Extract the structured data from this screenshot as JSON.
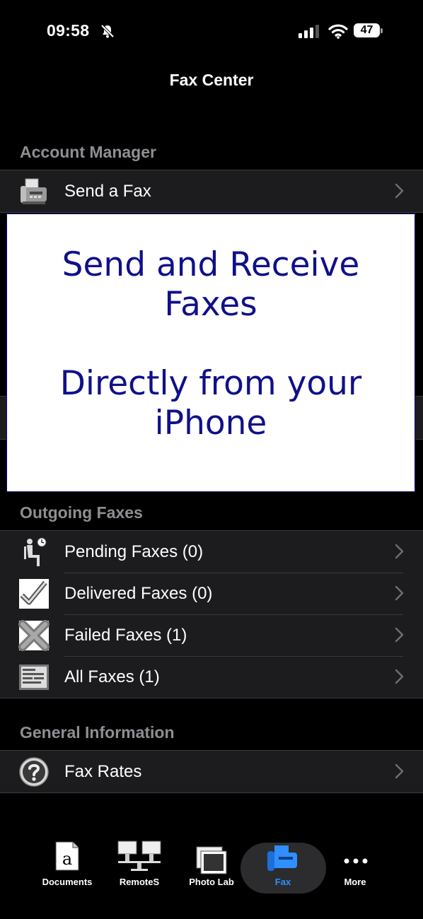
{
  "status_bar": {
    "time": "09:58",
    "battery": "47"
  },
  "nav": {
    "title": "Fax Center"
  },
  "sections": {
    "account": {
      "header": "Account Manager",
      "items": [
        {
          "label": "Send a Fax",
          "icon": "fax-machine-icon"
        }
      ]
    },
    "outgoing": {
      "header": "Outgoing Faxes",
      "items": [
        {
          "label": "Pending Faxes (0)",
          "icon": "waiting-person-clock-icon"
        },
        {
          "label": "Delivered Faxes (0)",
          "icon": "checkmark-icon"
        },
        {
          "label": "Failed Faxes (1)",
          "icon": "x-mark-icon"
        },
        {
          "label": "All Faxes (1)",
          "icon": "document-list-icon"
        }
      ]
    },
    "general": {
      "header": "General Information",
      "items": [
        {
          "label": "Fax Rates",
          "icon": "question-mark-icon"
        }
      ]
    }
  },
  "overlay": {
    "line1": "Send and Receive",
    "line2": "Faxes",
    "line3": "Directly from your",
    "line4": "iPhone"
  },
  "tabs": [
    {
      "label": "Documents",
      "icon": "document-a-icon"
    },
    {
      "label": "RemoteS",
      "icon": "network-computers-icon"
    },
    {
      "label": "Photo Lab",
      "icon": "photo-stack-icon"
    },
    {
      "label": "Fax",
      "icon": "fax-icon",
      "active": true
    },
    {
      "label": "More",
      "icon": "ellipsis-icon"
    }
  ],
  "colors": {
    "accent": "#2f8fff",
    "overlay_text": "#10108a",
    "cell_bg": "#1c1c1e"
  }
}
